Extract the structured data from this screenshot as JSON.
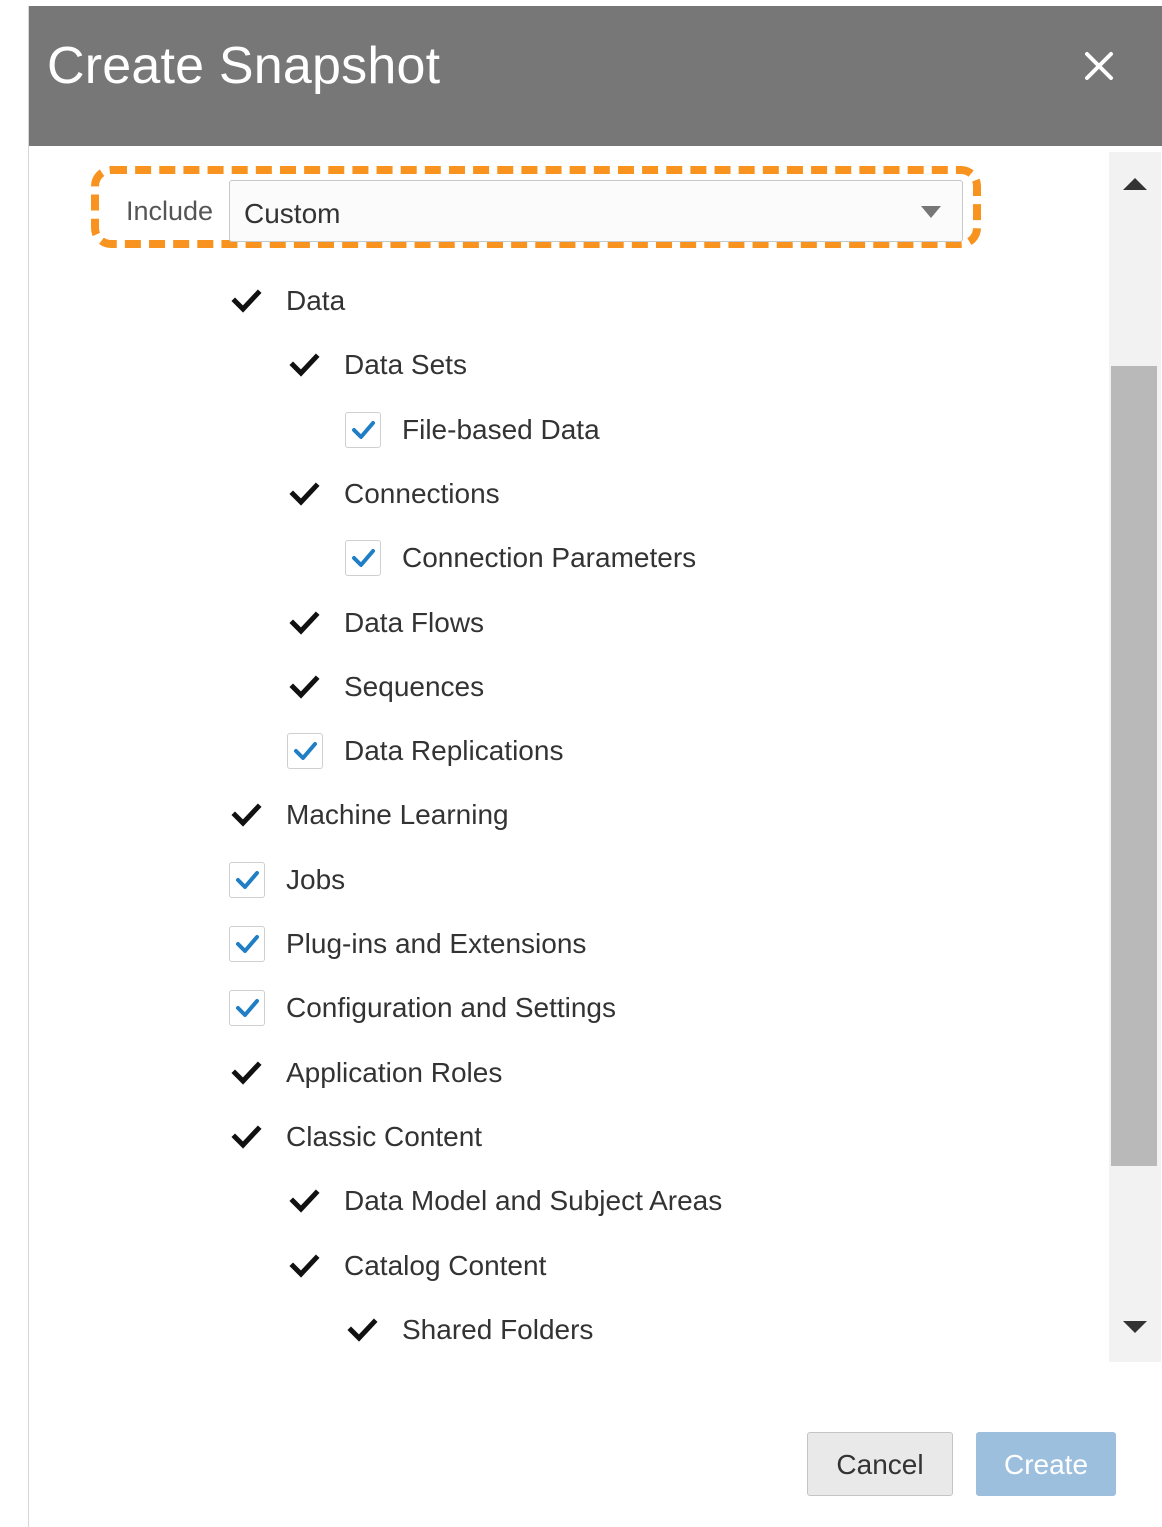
{
  "dialog": {
    "title": "Create Snapshot",
    "close_icon": "close-icon"
  },
  "include": {
    "label": "Include",
    "selected": "Custom"
  },
  "colors": {
    "titlebar": "#777777",
    "highlight": "#f7931e",
    "checkbox_check": "#1f7ec4",
    "create_button": "#9dbfde"
  },
  "items": [
    {
      "label": "Data",
      "level": 0,
      "control": "checkmark"
    },
    {
      "label": "Data Sets",
      "level": 1,
      "control": "checkmark"
    },
    {
      "label": "File-based Data",
      "level": 2,
      "control": "checkbox",
      "checked": true
    },
    {
      "label": "Connections",
      "level": 1,
      "control": "checkmark"
    },
    {
      "label": "Connection Parameters",
      "level": 2,
      "control": "checkbox",
      "checked": true
    },
    {
      "label": "Data Flows",
      "level": 1,
      "control": "checkmark"
    },
    {
      "label": "Sequences",
      "level": 1,
      "control": "checkmark"
    },
    {
      "label": "Data Replications",
      "level": 1,
      "control": "checkbox",
      "checked": true
    },
    {
      "label": "Machine Learning",
      "level": 0,
      "control": "checkmark"
    },
    {
      "label": "Jobs",
      "level": 0,
      "control": "checkbox",
      "checked": true
    },
    {
      "label": "Plug-ins and Extensions",
      "level": 0,
      "control": "checkbox",
      "checked": true
    },
    {
      "label": "Configuration and Settings",
      "level": 0,
      "control": "checkbox",
      "checked": true
    },
    {
      "label": "Application Roles",
      "level": 0,
      "control": "checkmark"
    },
    {
      "label": "Classic Content",
      "level": 0,
      "control": "checkmark"
    },
    {
      "label": "Data Model and Subject Areas",
      "level": 1,
      "control": "checkmark"
    },
    {
      "label": "Catalog Content",
      "level": 1,
      "control": "checkmark"
    },
    {
      "label": "Shared Folders",
      "level": 2,
      "control": "checkmark"
    }
  ],
  "footer": {
    "cancel_label": "Cancel",
    "create_label": "Create"
  }
}
